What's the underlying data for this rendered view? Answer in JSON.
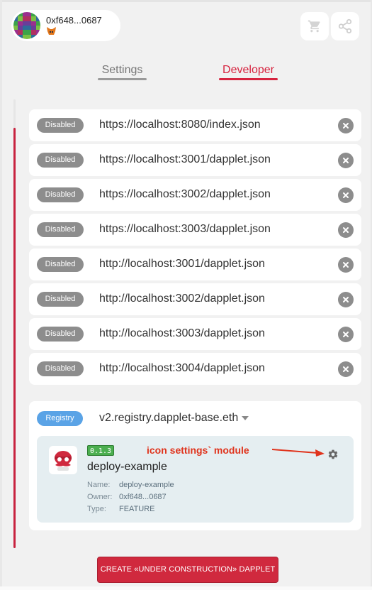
{
  "header": {
    "account_address": "0xf648...0687",
    "wallet_icon": "metamask-fox-icon",
    "avatar_colors": [
      "#6a3d9a",
      "#3ca34a",
      "#9a2f8e",
      "#2f6b9a",
      "#7bc043",
      "#b03060"
    ],
    "cart_icon": "cart-icon",
    "share_icon": "share-icon"
  },
  "tabs": [
    {
      "label": "Settings",
      "active": false
    },
    {
      "label": "Developer",
      "active": true
    }
  ],
  "registries": [
    {
      "status": "Disabled",
      "url": "https://localhost:8080/index.json"
    },
    {
      "status": "Disabled",
      "url": "https://localhost:3001/dapplet.json"
    },
    {
      "status": "Disabled",
      "url": "https://localhost:3002/dapplet.json"
    },
    {
      "status": "Disabled",
      "url": "https://localhost:3003/dapplet.json"
    },
    {
      "status": "Disabled",
      "url": "http://localhost:3001/dapplet.json"
    },
    {
      "status": "Disabled",
      "url": "http://localhost:3002/dapplet.json"
    },
    {
      "status": "Disabled",
      "url": "http://localhost:3003/dapplet.json"
    },
    {
      "status": "Disabled",
      "url": "http://localhost:3004/dapplet.json"
    }
  ],
  "registry_section": {
    "badge": "Registry",
    "name": "v2.registry.dapplet-base.eth",
    "module": {
      "version": "0.1.3",
      "title": "deploy-example",
      "name_label": "Name:",
      "name_value": "deploy-example",
      "owner_label": "Owner:",
      "owner_value": "0xf648...0687",
      "type_label": "Type:",
      "type_value": "FEATURE",
      "settings_icon": "gear-icon"
    }
  },
  "annotation": {
    "text": "icon settings` module",
    "color": "#e0331c"
  },
  "create_button": {
    "label": "CREATE «UNDER CONSTRUCTION» DAPPLET"
  },
  "colors": {
    "accent": "#d6233f",
    "disabled_badge": "#8d8d8d",
    "registry_badge": "#5aa3e6",
    "version_badge": "#4caf50"
  }
}
